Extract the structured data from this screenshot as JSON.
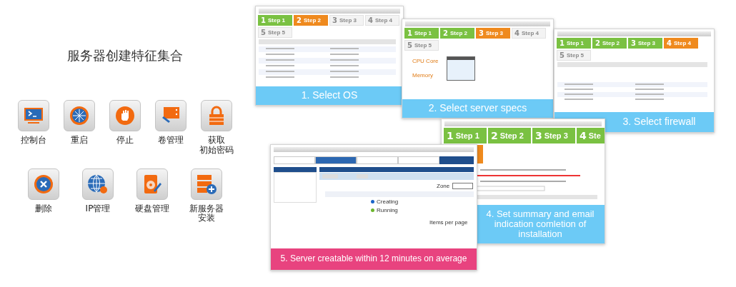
{
  "title": "服务器创建特征集合",
  "feature_rows": [
    [
      {
        "kind": "console",
        "lines": [
          "控制台"
        ]
      },
      {
        "kind": "restart",
        "lines": [
          "重启"
        ]
      },
      {
        "kind": "stop",
        "lines": [
          "停止"
        ]
      },
      {
        "kind": "volume",
        "lines": [
          "卷管理"
        ]
      },
      {
        "kind": "lock",
        "lines": [
          "获取",
          "初始密码"
        ]
      }
    ],
    [
      {
        "kind": "delete",
        "lines": [
          "删除"
        ]
      },
      {
        "kind": "globe",
        "lines": [
          "IP管理"
        ]
      },
      {
        "kind": "disk",
        "lines": [
          "硬盘管理"
        ]
      },
      {
        "kind": "newserver",
        "lines": [
          "新服务器",
          "安装"
        ]
      }
    ]
  ],
  "cards": [
    {
      "kind": "os",
      "caption": "1. Select OS",
      "color": "#6ccaf6",
      "steps": [
        {
          "number": "1",
          "label": "Step 1",
          "completed": true,
          "selected": false
        },
        {
          "number": "2",
          "label": "Step 2",
          "completed": false,
          "selected": true
        },
        {
          "number": "3",
          "label": "Step 3",
          "completed": false,
          "selected": false
        },
        {
          "number": "4",
          "label": "Step 4",
          "completed": false,
          "selected": false
        },
        {
          "number": "5",
          "label": "Step 5",
          "completed": false,
          "selected": false
        }
      ]
    },
    {
      "kind": "specs",
      "caption": "2. Select server specs",
      "color": "#6ccaf6",
      "steps": [
        {
          "number": "1",
          "label": "Step 1",
          "completed": true,
          "selected": false
        },
        {
          "number": "2",
          "label": "Step 2",
          "completed": true,
          "selected": false
        },
        {
          "number": "3",
          "label": "Step 3",
          "completed": false,
          "selected": true
        },
        {
          "number": "4",
          "label": "Step 4",
          "completed": false,
          "selected": false
        },
        {
          "number": "5",
          "label": "Step 5",
          "completed": false,
          "selected": false
        }
      ],
      "options": [
        "CPU Core",
        "Memory"
      ]
    },
    {
      "kind": "firewall",
      "caption": "3. Select firewall",
      "color": "#6ccaf6",
      "steps": [
        {
          "number": "1",
          "label": "Step 1",
          "completed": true,
          "selected": false
        },
        {
          "number": "2",
          "label": "Step 2",
          "completed": true,
          "selected": false
        },
        {
          "number": "3",
          "label": "Step 3",
          "completed": true,
          "selected": false
        },
        {
          "number": "4",
          "label": "Step 4",
          "completed": false,
          "selected": true
        },
        {
          "number": "5",
          "label": "Step 5",
          "completed": false,
          "selected": false
        }
      ]
    },
    {
      "kind": "summary",
      "caption": "4. Set summary and email indication comletion of installation",
      "color": "#6ccaf6",
      "steps": [
        {
          "number": "1",
          "label": "Step 1",
          "completed": true,
          "selected": false
        },
        {
          "number": "2",
          "label": "Step 2",
          "completed": true,
          "selected": false
        },
        {
          "number": "3",
          "label": "Step 3",
          "completed": true,
          "selected": false
        },
        {
          "number": "4",
          "label": "Ste",
          "completed": true,
          "selected": false
        },
        {
          "completed": false,
          "selected": true
        }
      ]
    },
    {
      "kind": "list",
      "caption": "5. Server creatable within 12 minutes on average",
      "color": "#e8437f",
      "tabs": [
        {
          "selected": false
        },
        {
          "selected": true
        },
        {
          "selected": false
        },
        {
          "selected": false
        }
      ],
      "zone_label": "Zone",
      "rows": [
        {
          "status": "Creating",
          "color": "#1a64c8"
        },
        {
          "status": "Running",
          "color": "#6cb52d"
        }
      ],
      "pager_label": "Items per page"
    }
  ]
}
